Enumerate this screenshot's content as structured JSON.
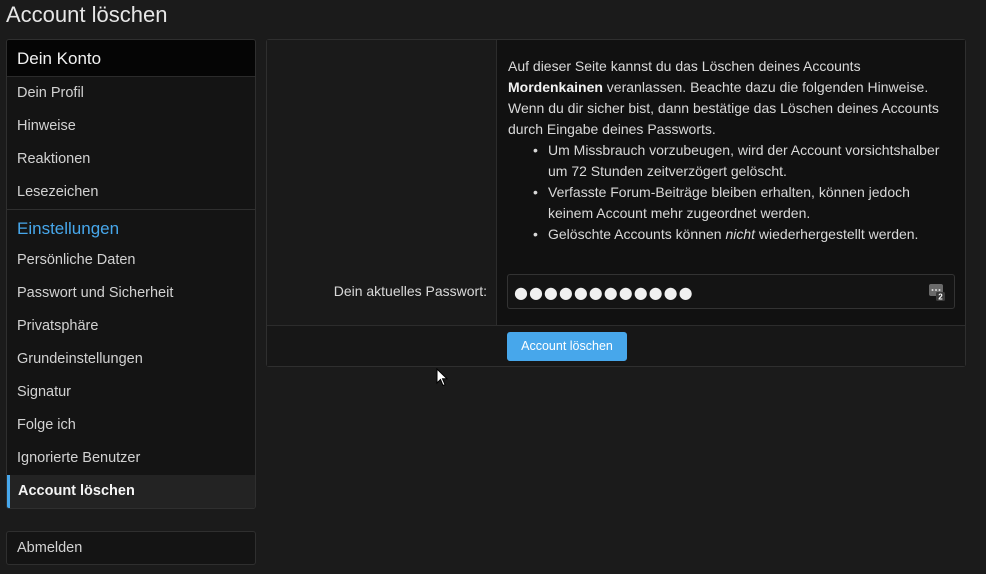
{
  "page": {
    "title": "Account löschen"
  },
  "sidebar": {
    "section1_title": "Dein Konto",
    "section1_items": [
      "Dein Profil",
      "Hinweise",
      "Reaktionen",
      "Lesezeichen"
    ],
    "section2_title": "Einstellungen",
    "section2_items": [
      "Persönliche Daten",
      "Passwort und Sicherheit",
      "Privatsphäre",
      "Grundeinstellungen",
      "Signatur",
      "Folge ich",
      "Ignorierte Benutzer"
    ],
    "active_item": "Account löschen",
    "logout": "Abmelden"
  },
  "form": {
    "intro_1": "Auf dieser Seite kannst du das Löschen deines Accounts",
    "account_name": "Mordenkainen",
    "intro_2": " veranlassen. Beachte dazu die folgenden Hinweise. Wenn du dir sicher bist, dann bestätige das Löschen deines Accounts durch Eingabe deines Passworts.",
    "note_1": "Um Missbrauch vorzubeugen, wird der Account vorsichtshalber um 72 Stunden zeitverzögert gelöscht.",
    "note_2": "Verfasste Forum-Beiträge bleiben erhalten, können jedoch keinem Account mehr zugeordnet werden.",
    "note_3a": "Gelöschte Accounts können ",
    "note_3b": "nicht",
    "note_3c": " wiederhergestellt werden.",
    "password_label": "Dein aktuelles Passwort:",
    "password_value": "●●●●●●●●●●●●",
    "password_manager_icon": "password-manager-icon",
    "submit_label": "Account löschen"
  },
  "colors": {
    "accent": "#47a7eb",
    "background": "#1b1b1b"
  }
}
